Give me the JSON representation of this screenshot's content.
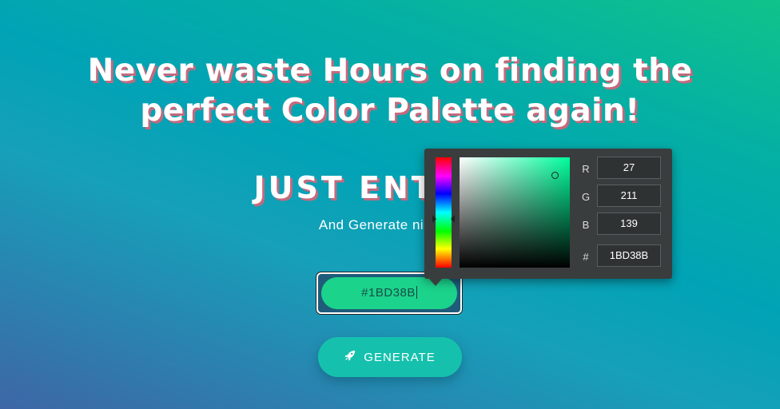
{
  "hero": {
    "headline_line1": "Never waste Hours on finding the",
    "headline_line2": "perfect Color Palette again!",
    "subhead": "JUST ENTER A",
    "tagline": "And Generate nice Co"
  },
  "color_input": {
    "value": "#1BD38B"
  },
  "generate_button": {
    "label": "GENERATE",
    "icon": "rocket-icon"
  },
  "color_picker": {
    "r_label": "R",
    "g_label": "G",
    "b_label": "B",
    "hex_label": "#",
    "r_value": "27",
    "g_value": "211",
    "b_value": "139",
    "hex_value": "1BD38B"
  },
  "colors": {
    "accent": "#1bd38b",
    "button": "#15c1ad",
    "picker_bg": "#3a3d3e",
    "title_shadow": "#c36a7d"
  }
}
